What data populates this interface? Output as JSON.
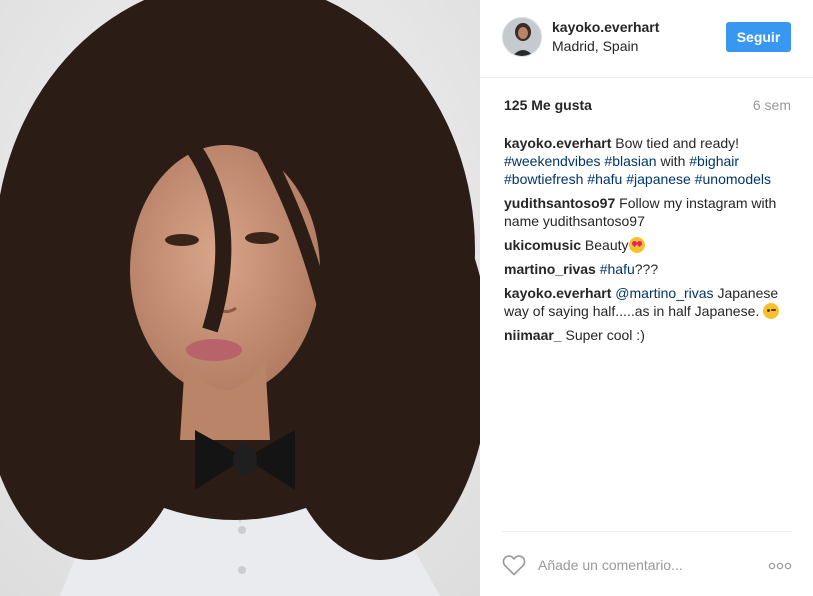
{
  "post": {
    "author": "kayoko.everhart",
    "location": "Madrid, Spain",
    "follow_label": "Seguir",
    "likes": "125 Me gusta",
    "time": "6 sem"
  },
  "comments": [
    {
      "author": "kayoko.everhart",
      "text": "Bow tied and ready!",
      "hashtags": [
        "#weekendvibes",
        "#blasian",
        "with",
        "#bighair",
        "#bowtiefresh",
        "#hafu",
        "#japanese",
        "#unomodels"
      ]
    },
    {
      "author": "yudithsantoso97",
      "text": "Follow my instagram with name yudithsantoso97"
    },
    {
      "author": "ukicomusic",
      "text": "Beauty",
      "emoji": "heart-eyes"
    },
    {
      "author": "martino_rivas",
      "mention": "#hafu",
      "text": "???"
    },
    {
      "author": "kayoko.everhart",
      "mention": "@martino_rivas",
      "text": "Japanese way of saying half.....as in half Japanese.",
      "emoji": "wink"
    },
    {
      "author": "niimaar_",
      "text": "Super cool :)"
    }
  ],
  "footer": {
    "comment_placeholder": "Añade un comentario...",
    "like_icon": "heart-outline-icon",
    "more_icon": "more-options-icon"
  },
  "colors": {
    "follow_button": "#3897f0",
    "hashtag": "#003569",
    "muted": "#999999"
  }
}
